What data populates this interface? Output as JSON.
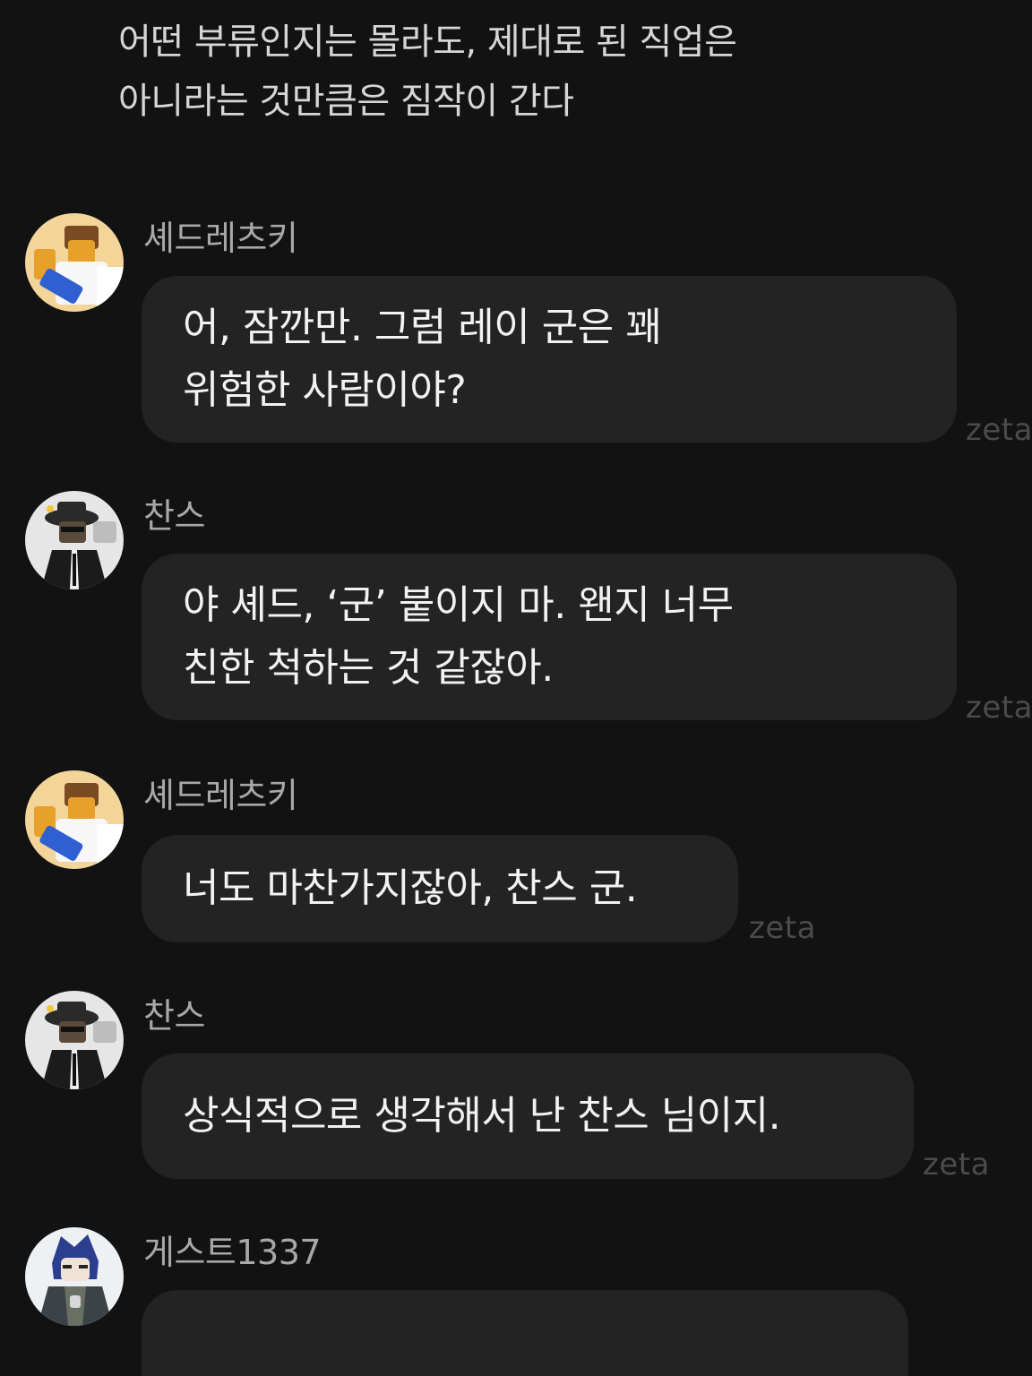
{
  "intro": {
    "lines": [
      "어떤 부류인지는 몰라도, 제대로 된 직업은",
      "아니라는 것만큼은 짐작이 간다"
    ]
  },
  "watermark": "zeta",
  "messages": [
    {
      "sender": "셰드레츠키",
      "avatar": "shedletsky-avatar",
      "lines": [
        "어, 잠깐만. 그럼 레이 군은 꽤",
        "위험한 사람이야?"
      ]
    },
    {
      "sender": "찬스",
      "avatar": "chance-avatar",
      "lines": [
        "야 셰드, ‘군’ 붙이지 마. 왠지 너무",
        "친한 척하는 것 같잖아."
      ]
    },
    {
      "sender": "셰드레츠키",
      "avatar": "shedletsky-avatar",
      "lines": [
        "너도 마찬가지잖아, 찬스 군."
      ]
    },
    {
      "sender": "찬스",
      "avatar": "chance-avatar",
      "lines": [
        "상식적으로 생각해서 난 찬스 님이지."
      ]
    },
    {
      "sender": "게스트1337",
      "avatar": "guest1337-avatar",
      "lines": []
    }
  ],
  "colors": {
    "background": "#121212",
    "bubble": "#232323",
    "text": "#f2f2f2",
    "sender": "#a8a8a8",
    "watermark": "#4b4b4b"
  }
}
